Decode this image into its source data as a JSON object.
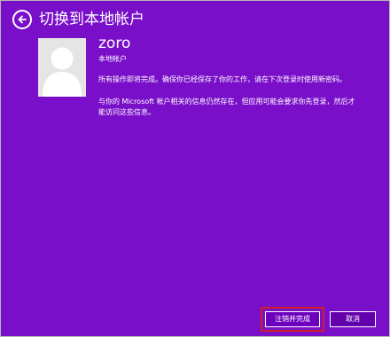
{
  "header": {
    "title": "切换到本地帐户",
    "back_icon": "arrow-left-circle-icon"
  },
  "account": {
    "username": "zoro",
    "type": "本地帐户",
    "avatar_icon": "user-silhouette-icon"
  },
  "messages": [
    "所有操作即将完成。确保你已经保存了你的工作，请在下次登录时使用新密码。",
    "与你的 Microsoft 帐户相关的信息仍然存在，但应用可能会要求你先登录，然后才能访问这些信息。"
  ],
  "buttons": {
    "done": "注销并完成",
    "cancel": "取消"
  },
  "colors": {
    "background": "#7a0fca",
    "text": "#ffffff",
    "avatar_bg": "#e5e5e5",
    "highlight": "#d11e25"
  }
}
